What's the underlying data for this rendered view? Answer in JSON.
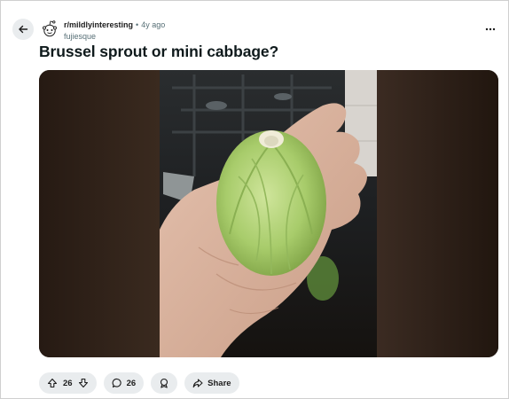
{
  "post": {
    "subreddit": "r/mildlyinteresting",
    "separator": "•",
    "age": "4y ago",
    "author": "fujiesque",
    "title": "Brussel sprout or mini cabbage?"
  },
  "actions": {
    "votes": "26",
    "comments": "26",
    "share_label": "Share"
  },
  "icons": {
    "back": "arrow-left-icon",
    "avatar": "snoo-avatar-icon",
    "more": "more-horizontal-icon",
    "upvote": "upvote-arrow-icon",
    "downvote": "downvote-arrow-icon",
    "comment": "comment-bubble-icon",
    "award": "award-icon",
    "share": "share-arrow-icon"
  },
  "colors": {
    "pill_background": "#e9ecee",
    "title": "#0f1a1c",
    "muted_text": "#576f76"
  }
}
